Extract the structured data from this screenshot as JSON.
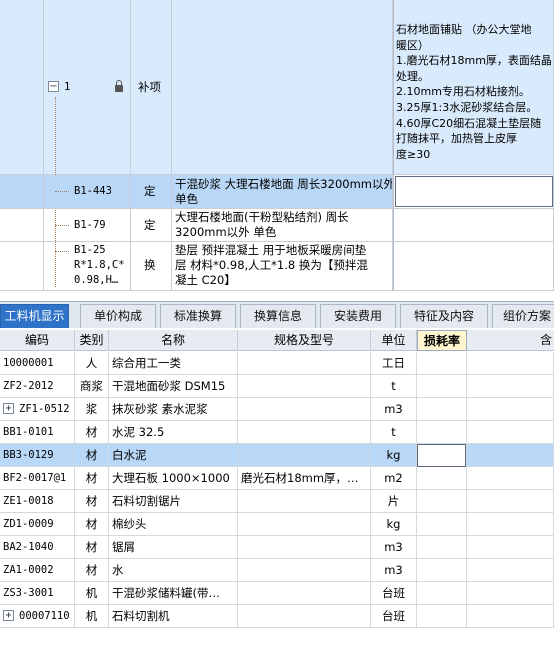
{
  "upper": {
    "parent": {
      "index": "1",
      "type": "补项",
      "description_lines": [
        "石材地面铺贴 （办公大堂地",
        "暖区）",
        "1.磨光石材18mm厚，表面结晶",
        "处理。",
        "2.10mm专用石材粘接剂。",
        "3.25厚1:3水泥砂浆结合层。",
        "4.60厚C20细石混凝土垫层随",
        "打随抹平，加热管上皮厚",
        "度≥30"
      ]
    },
    "rows": [
      {
        "code_lines": [
          "B1-443"
        ],
        "type": "定",
        "name_lines": [
          "干混砂浆 大理石楼地面 周长3200mm以外",
          "单色"
        ]
      },
      {
        "code_lines": [
          "B1-79"
        ],
        "type": "定",
        "name_lines": [
          "大理石楼地面(干粉型粘结剂) 周长",
          "3200mm以外 单色"
        ]
      },
      {
        "code_lines": [
          "B1-25",
          "R*1.8,C*",
          "0.98,H…"
        ],
        "type": "换",
        "name_lines": [
          "垫层 预拌混凝土  用于地板采暖房间垫",
          "层 材料*0.98,人工*1.8  换为【预拌混",
          "凝土 C20】"
        ]
      }
    ]
  },
  "tabs": [
    "工料机显示",
    "单价构成",
    "标准换算",
    "换算信息",
    "安装费用",
    "特征及内容",
    "组价方案"
  ],
  "table": {
    "headers": [
      "编码",
      "类别",
      "名称",
      "规格及型号",
      "单位",
      "损耗率",
      "含"
    ],
    "rows": [
      {
        "code": "10000001",
        "cat": "人",
        "name": "综合用工一类",
        "spec": "",
        "unit": "工日",
        "expand": false
      },
      {
        "code": "ZF2-2012",
        "cat": "商浆",
        "name": "干混地面砂浆 DSM15",
        "spec": "",
        "unit": "t",
        "expand": false
      },
      {
        "code": "ZF1-0512",
        "cat": "浆",
        "name": "抹灰砂浆 素水泥浆",
        "spec": "",
        "unit": "m3",
        "expand": true
      },
      {
        "code": "BB1-0101",
        "cat": "材",
        "name": "水泥 32.5",
        "spec": "",
        "unit": "t",
        "expand": false
      },
      {
        "code": "BB3-0129",
        "cat": "材",
        "name": "白水泥",
        "spec": "",
        "unit": "kg",
        "expand": false
      },
      {
        "code": "BF2-0017@1",
        "cat": "材",
        "name": "大理石板 1000×1000",
        "spec": "磨光石材18mm厚，表…",
        "unit": "m2",
        "expand": false
      },
      {
        "code": "ZE1-0018",
        "cat": "材",
        "name": "石料切割锯片",
        "spec": "",
        "unit": "片",
        "expand": false
      },
      {
        "code": "ZD1-0009",
        "cat": "材",
        "name": "棉纱头",
        "spec": "",
        "unit": "kg",
        "expand": false
      },
      {
        "code": "BA2-1040",
        "cat": "材",
        "name": "锯屑",
        "spec": "",
        "unit": "m3",
        "expand": false
      },
      {
        "code": "ZA1-0002",
        "cat": "材",
        "name": "水",
        "spec": "",
        "unit": "m3",
        "expand": false
      },
      {
        "code": "ZS3-3001",
        "cat": "机",
        "name": "干混砂浆储料罐(带…",
        "spec": "",
        "unit": "台班",
        "expand": false
      },
      {
        "code": "00007110",
        "cat": "机",
        "name": "石料切割机",
        "spec": "",
        "unit": "台班",
        "expand": true
      }
    ]
  },
  "colors": {
    "accent": "#2f73c8",
    "selected_row": "#b9d8f7",
    "parent_row": "#d9eafc"
  }
}
